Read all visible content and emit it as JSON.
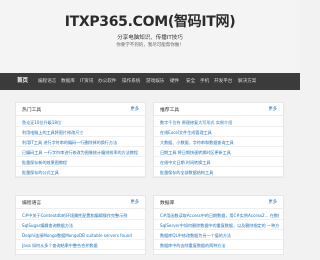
{
  "header": {
    "site_title": "ITXP365.COM(智码IT网)",
    "tagline": "分享电脑知识、传播IT技巧",
    "tagline2": "你要学不到的，我尽可能帮你做！"
  },
  "nav": {
    "items": [
      "首页",
      "编程语言",
      "数据库",
      "IT资讯",
      "办公软件",
      "操作系统",
      "游戏娱乐",
      "硬件",
      "安全",
      "手机",
      "开发平台",
      "解决方案"
    ]
  },
  "panels": {
    "hot_tools": {
      "title": "热门工具",
      "more": "更多",
      "items": [
        "鱼论证10位升级18位",
        "利用电脑上的工具将图片修改尺寸",
        "利用IT工具 进行字符串的编码一行删除掉的换行方法",
        "已编码工具 一行字符串进行修改为图像统计编排效率的方法教程",
        "批量保存新的效果图教程",
        "批量保存的公式工具"
      ]
    },
    "recommended_tools": {
      "title": "推荐工具",
      "more": "更多",
      "items": [
        "数字千位符 原理修复大写形式 实例介绍",
        "在线Excel文件生成管理工具",
        "大数据、小数据、字符串和数据查询工具",
        "日期工具 将日期快速转换时区更新工具",
        "在线中文日期 时间转换工具",
        "批量保存的全部数据结构工具"
      ]
    },
    "programming": {
      "title": "编程语言",
      "more": "更多",
      "items": [
        "C#中关于Contextdb的环境属性配置和编辑操作完整示例",
        "SqlSugar编辑查询数据方法",
        "Delphi连接Mongo数据MongoDB suitable servers found",
        "Java 如何从多个查询结果中整合合并数据"
      ]
    },
    "database": {
      "title": "数据库",
      "more": "更多",
      "items": [
        "C#用函数读取Access中的日期数据，用C#实例Access2... 在数据库中执",
        "SqlServer中如何删除数据中的重复数据，以及删除指定的 一种方法",
        "数据库QL中修改数据为另一个值的方法",
        "数据库中的去除重复数据的两种方法"
      ]
    }
  }
}
